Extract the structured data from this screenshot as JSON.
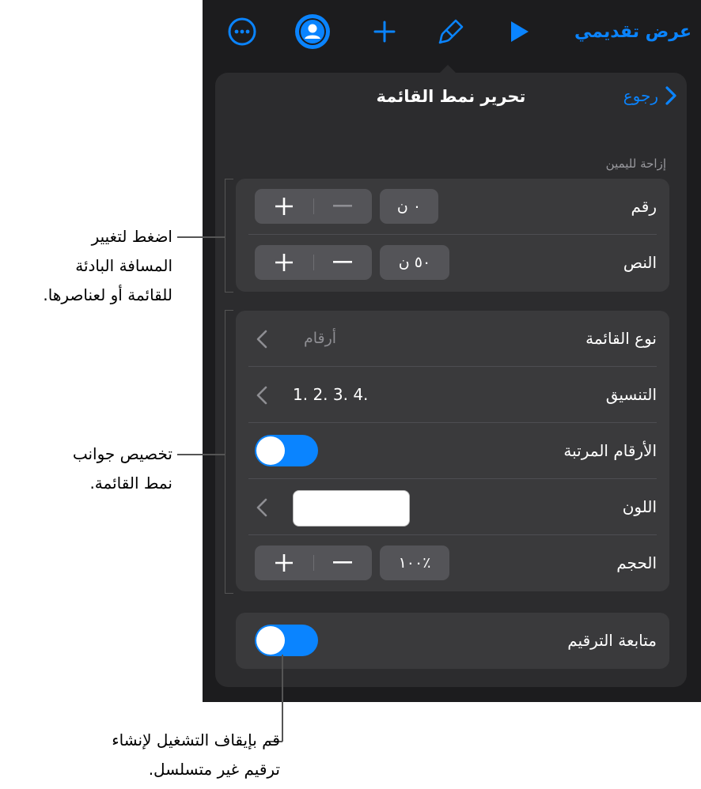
{
  "toolbar": {
    "title": "عرض تقديمي",
    "icons": [
      "more-icon",
      "collaborate-icon",
      "add-icon",
      "format-brush-icon",
      "play-icon"
    ]
  },
  "popover": {
    "title": "تحرير نمط القائمة",
    "back_label": "رجوع",
    "indent_section_label": "إزاحة لليمين",
    "indent": {
      "number_label": "رقم",
      "number_value": "٠ ن",
      "text_label": "النص",
      "text_value": "٥٠ ن"
    },
    "style": {
      "list_type_label": "نوع القائمة",
      "list_type_value": "أرقام",
      "format_label": "التنسيق",
      "format_value": "1. 2. 3. 4.",
      "tiered_label": "الأرقام المرتبة",
      "tiered_on": true,
      "color_label": "اللون",
      "color_value": "#ffffff",
      "size_label": "الحجم",
      "size_value": "٪١٠٠"
    },
    "continue_label": "متابعة الترقيم",
    "continue_on": true
  },
  "callouts": {
    "indent": [
      "اضغط لتغيير",
      "المسافة البادئة",
      "للقائمة أو لعناصرها."
    ],
    "customize": [
      "تخصيص جوانب",
      "نمط القائمة."
    ],
    "continue": [
      "قم بإيقاف التشغيل لإنشاء",
      "ترقيم غير متسلسل."
    ]
  },
  "colors": {
    "accent": "#0a84ff",
    "panel": "#2c2c2e",
    "group": "#3a3a3c",
    "background": "#1c1c1e"
  }
}
